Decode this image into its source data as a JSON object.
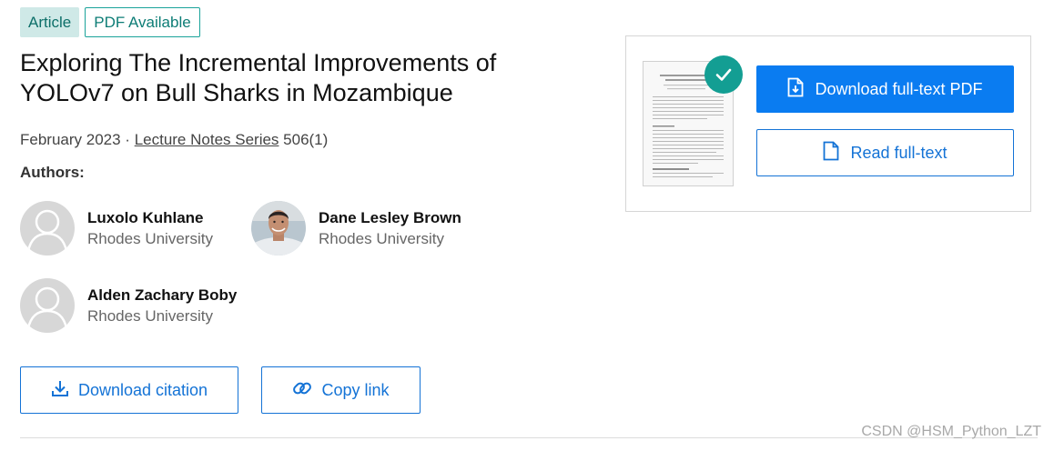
{
  "badges": {
    "article": "Article",
    "pdf": "PDF Available"
  },
  "publication": {
    "title": "Exploring The Incremental Improvements of YOLOv7 on Bull Sharks in Mozambique",
    "date_prefix": "February 2023 · ",
    "series": "Lecture Notes Series",
    "issue": " 506(1)"
  },
  "authors_label": "Authors:",
  "authors": [
    {
      "name": "Luxolo Kuhlane",
      "affiliation": "Rhodes University"
    },
    {
      "name": "Dane Lesley Brown",
      "affiliation": "Rhodes University"
    },
    {
      "name": "Alden Zachary Boby",
      "affiliation": "Rhodes University"
    }
  ],
  "actions": {
    "download_citation": "Download citation",
    "copy_link": "Copy link"
  },
  "card": {
    "download_pdf": "Download full-text PDF",
    "read_fulltext": "Read full-text"
  },
  "watermark": "CSDN @HSM_Python_LZT",
  "colors": {
    "primary": "#0a7cf1",
    "teal": "#139e93",
    "link_blue": "#1473d6"
  }
}
